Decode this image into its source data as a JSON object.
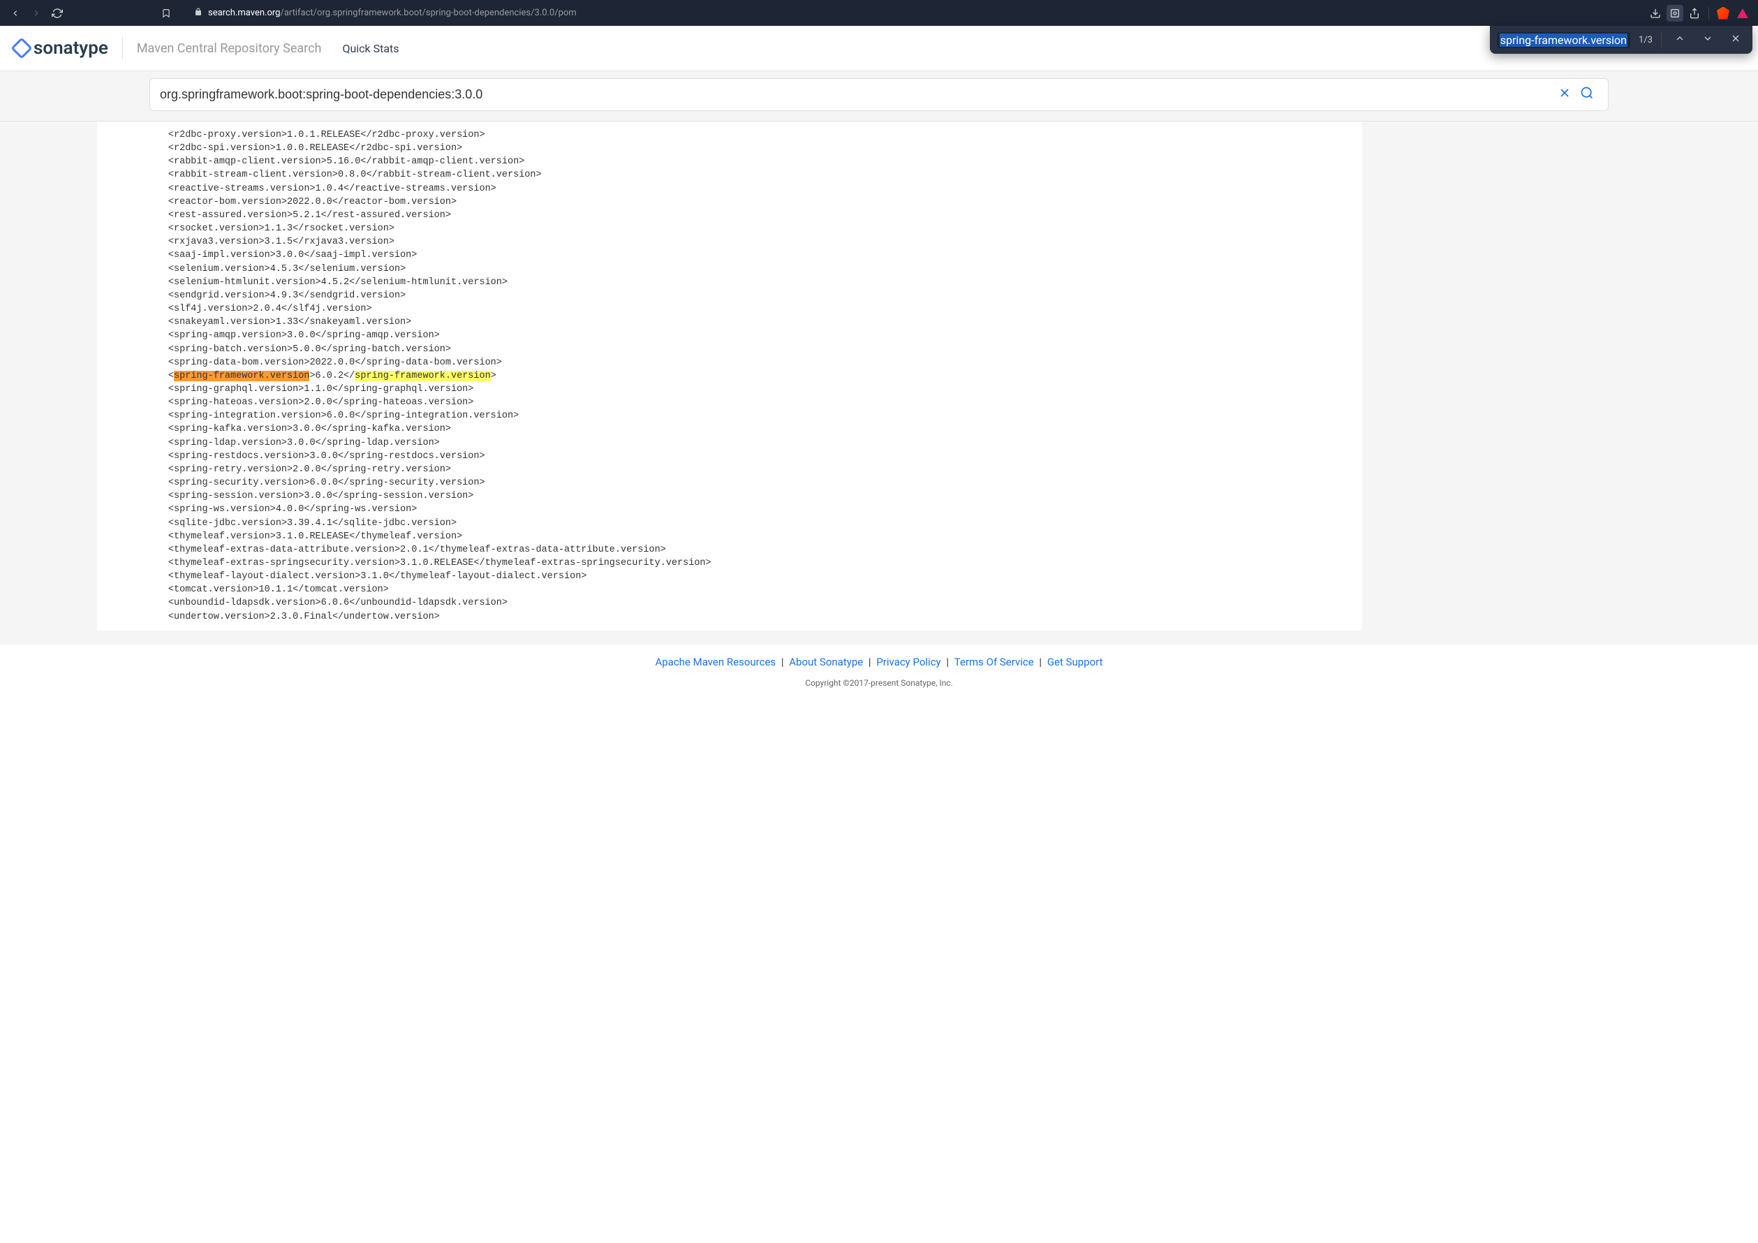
{
  "browser": {
    "url_domain": "search.maven.org",
    "url_path": "/artifact/org.springframework.boot/spring-boot-dependencies/3.0.0/pom"
  },
  "find": {
    "query": "spring-framework.version",
    "count": "1/3"
  },
  "header": {
    "logo_text": "sonatype",
    "title": "Maven Central Repository Search",
    "quick_stats": "Quick Stats"
  },
  "search": {
    "value": "org.springframework.boot:spring-boot-dependencies:3.0.0"
  },
  "pom_lines": [
    {
      "tag": "r2dbc-proxy.version",
      "val": "1.0.1.RELEASE"
    },
    {
      "tag": "r2dbc-spi.version",
      "val": "1.0.0.RELEASE"
    },
    {
      "tag": "rabbit-amqp-client.version",
      "val": "5.16.0"
    },
    {
      "tag": "rabbit-stream-client.version",
      "val": "0.8.0"
    },
    {
      "tag": "reactive-streams.version",
      "val": "1.0.4"
    },
    {
      "tag": "reactor-bom.version",
      "val": "2022.0.0"
    },
    {
      "tag": "rest-assured.version",
      "val": "5.2.1"
    },
    {
      "tag": "rsocket.version",
      "val": "1.1.3"
    },
    {
      "tag": "rxjava3.version",
      "val": "3.1.5"
    },
    {
      "tag": "saaj-impl.version",
      "val": "3.0.0"
    },
    {
      "tag": "selenium.version",
      "val": "4.5.3"
    },
    {
      "tag": "selenium-htmlunit.version",
      "val": "4.5.2"
    },
    {
      "tag": "sendgrid.version",
      "val": "4.9.3"
    },
    {
      "tag": "slf4j.version",
      "val": "2.0.4"
    },
    {
      "tag": "snakeyaml.version",
      "val": "1.33"
    },
    {
      "tag": "spring-amqp.version",
      "val": "3.0.0"
    },
    {
      "tag": "spring-batch.version",
      "val": "5.0.0"
    },
    {
      "tag": "spring-data-bom.version",
      "val": "2022.0.0"
    },
    {
      "tag": "spring-framework.version",
      "val": "6.0.2",
      "highlight": true
    },
    {
      "tag": "spring-graphql.version",
      "val": "1.1.0"
    },
    {
      "tag": "spring-hateoas.version",
      "val": "2.0.0"
    },
    {
      "tag": "spring-integration.version",
      "val": "6.0.0"
    },
    {
      "tag": "spring-kafka.version",
      "val": "3.0.0"
    },
    {
      "tag": "spring-ldap.version",
      "val": "3.0.0"
    },
    {
      "tag": "spring-restdocs.version",
      "val": "3.0.0"
    },
    {
      "tag": "spring-retry.version",
      "val": "2.0.0"
    },
    {
      "tag": "spring-security.version",
      "val": "6.0.0"
    },
    {
      "tag": "spring-session.version",
      "val": "3.0.0"
    },
    {
      "tag": "spring-ws.version",
      "val": "4.0.0"
    },
    {
      "tag": "sqlite-jdbc.version",
      "val": "3.39.4.1"
    },
    {
      "tag": "thymeleaf.version",
      "val": "3.1.0.RELEASE"
    },
    {
      "tag": "thymeleaf-extras-data-attribute.version",
      "val": "2.0.1"
    },
    {
      "tag": "thymeleaf-extras-springsecurity.version",
      "val": "3.1.0.RELEASE"
    },
    {
      "tag": "thymeleaf-layout-dialect.version",
      "val": "3.1.0"
    },
    {
      "tag": "tomcat.version",
      "val": "10.1.1"
    },
    {
      "tag": "unboundid-ldapsdk.version",
      "val": "6.0.6"
    },
    {
      "tag": "undertow.version",
      "val": "2.3.0.Final"
    }
  ],
  "footer": {
    "links": [
      "Apache Maven Resources",
      "About Sonatype",
      "Privacy Policy",
      "Terms Of Service",
      "Get Support"
    ],
    "copyright": "Copyright ©2017-present Sonatype, Inc."
  }
}
